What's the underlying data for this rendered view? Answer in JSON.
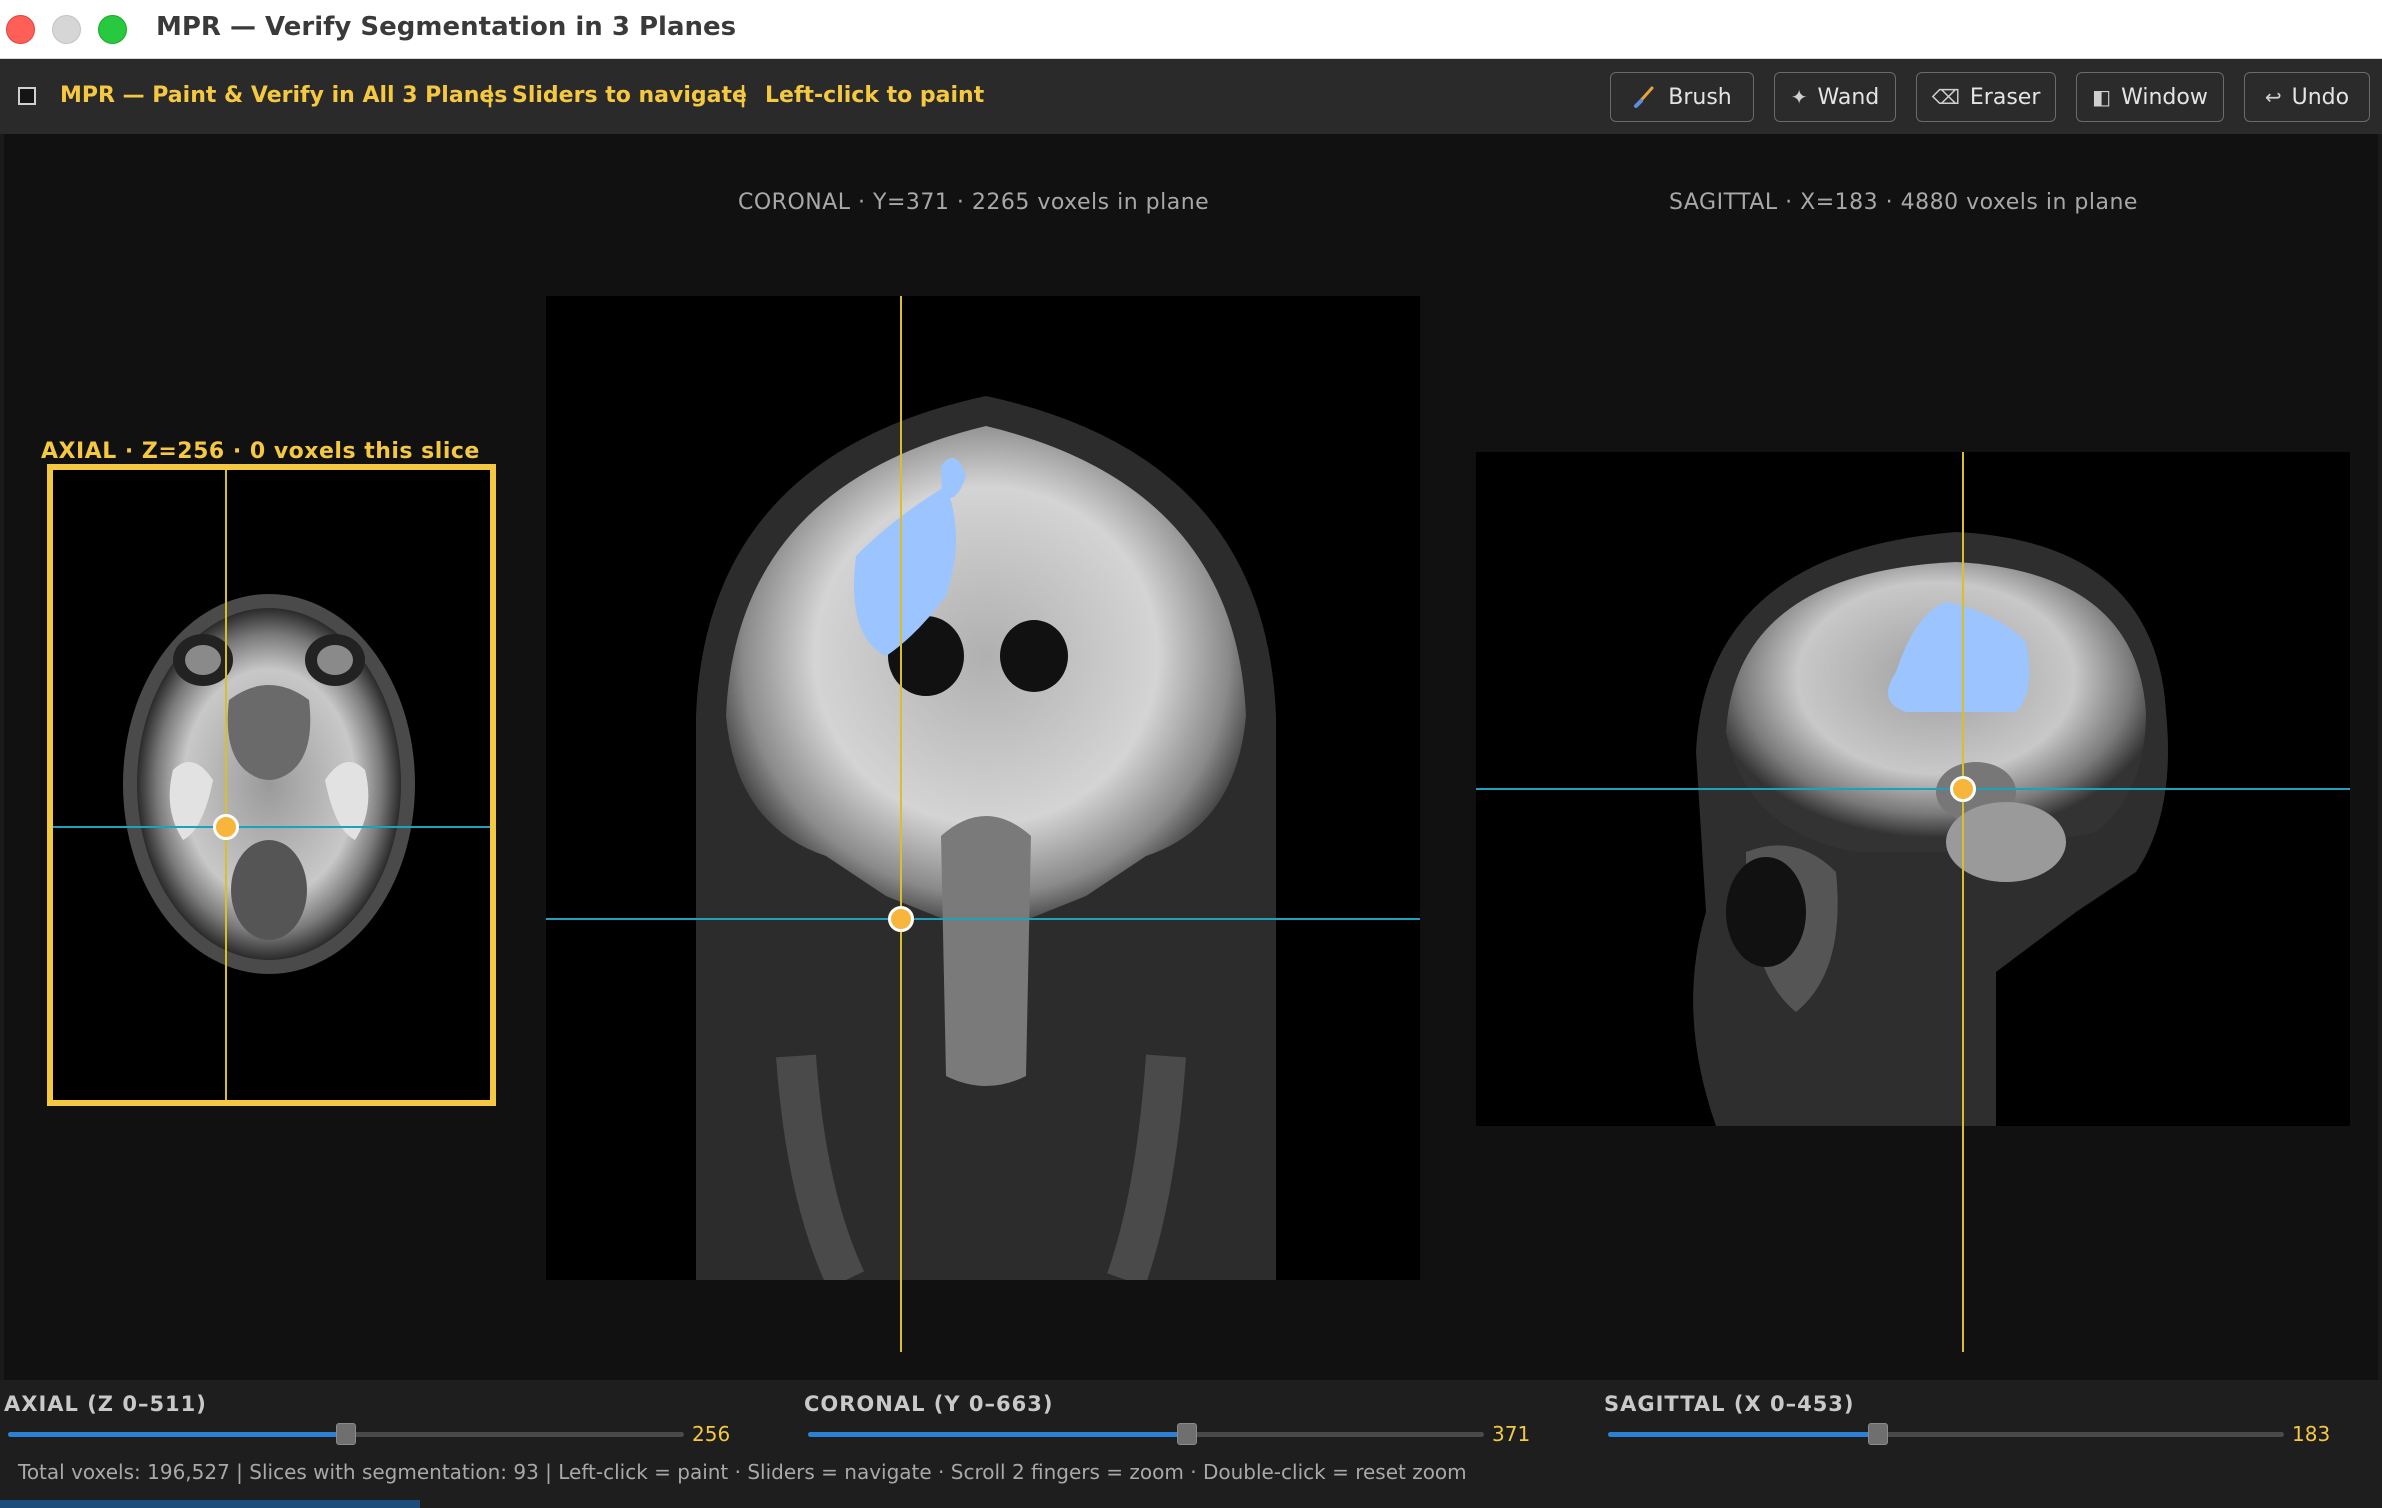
{
  "window": {
    "title": "MPR — Verify Segmentation in 3 Planes"
  },
  "toolbar": {
    "title": "MPR — Paint & Verify in All 3 Planes",
    "sep1": "|",
    "hint_navigate": "Sliders to navigate",
    "sep2": "|",
    "hint_paint": "Left-click to paint",
    "tools": [
      {
        "label": "Brush",
        "icon": "brush-icon"
      },
      {
        "label": "Wand",
        "icon": "wand-icon"
      },
      {
        "label": "Eraser",
        "icon": "eraser-icon"
      },
      {
        "label": "Window",
        "icon": "window-icon"
      },
      {
        "label": "Undo",
        "icon": "undo-icon"
      }
    ]
  },
  "views": {
    "axial": {
      "label": "AXIAL  ·  Z=256  ·  0 voxels this slice",
      "active": true
    },
    "coronal": {
      "label": "CORONAL  ·  Y=371  ·  2265 voxels in plane"
    },
    "sagittal": {
      "label": "SAGITTAL  ·  X=183  ·  4880 voxels in plane"
    }
  },
  "sliders": [
    {
      "label": "AXIAL  (Z  0–511)",
      "value": "256",
      "fraction": 0.5
    },
    {
      "label": "CORONAL  (Y  0–663)",
      "value": "371",
      "fraction": 0.56
    },
    {
      "label": "SAGITTAL  (X  0–453)",
      "value": "183",
      "fraction": 0.4
    }
  ],
  "status": "Total voxels: 196,527   |   Slices with segmentation: 93   |   Left-click = paint   ·   Sliders = navigate   ·   Scroll 2 fingers = zoom   ·   Double-click = reset zoom",
  "colors": {
    "accent": "#f5c842",
    "crosshair_vertical": "#d9c02a",
    "crosshair_horizontal": "#1fa0bd",
    "segmentation": "#9cc4ff",
    "slider_fill": "#2e7fd6"
  }
}
